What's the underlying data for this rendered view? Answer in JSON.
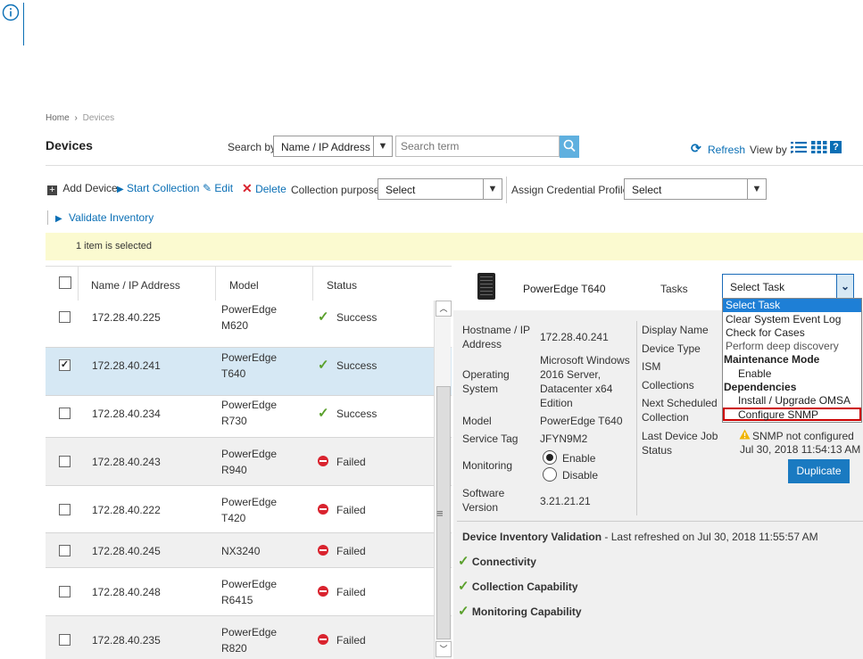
{
  "breadcrumb": {
    "home": "Home",
    "sep": "›",
    "current": "Devices"
  },
  "page_title": "Devices",
  "search": {
    "label": "Search by",
    "field_value": "Name / IP Address",
    "placeholder": "Search term"
  },
  "view": {
    "refresh": "Refresh",
    "view_by": "View by :",
    "help": "?"
  },
  "toolbar": {
    "add_device": "Add Device",
    "start_collection": "Start Collection",
    "edit": "Edit",
    "delete": "Delete",
    "collection_purpose_label": "Collection purpose",
    "collection_purpose_value": "Select",
    "assign_credential_label": "Assign Credential Profile",
    "assign_credential_value": "Select",
    "validate_inventory": "Validate Inventory"
  },
  "selection_banner": "1 item is selected",
  "table": {
    "headers": {
      "name": "Name / IP Address",
      "model": "Model",
      "status": "Status"
    },
    "rows": [
      {
        "ip": "172.28.40.225",
        "model_line1": "PowerEdge",
        "model_line2": "M620",
        "status": "Success",
        "checked": false
      },
      {
        "ip": "172.28.40.241",
        "model_line1": "PowerEdge",
        "model_line2": "T640",
        "status": "Success",
        "checked": true
      },
      {
        "ip": "172.28.40.234",
        "model_line1": "PowerEdge",
        "model_line2": "R730",
        "status": "Success",
        "checked": false
      },
      {
        "ip": "172.28.40.243",
        "model_line1": "PowerEdge",
        "model_line2": "R940",
        "status": "Failed",
        "checked": false
      },
      {
        "ip": "172.28.40.222",
        "model_line1": "PowerEdge",
        "model_line2": "T420",
        "status": "Failed",
        "checked": false
      },
      {
        "ip": "172.28.40.245",
        "model_line1": "NX3240",
        "model_line2": "",
        "status": "Failed",
        "checked": false
      },
      {
        "ip": "172.28.40.248",
        "model_line1": "PowerEdge",
        "model_line2": "R6415",
        "status": "Failed",
        "checked": false
      },
      {
        "ip": "172.28.40.235",
        "model_line1": "PowerEdge",
        "model_line2": "R820",
        "status": "Failed",
        "checked": false
      }
    ]
  },
  "details": {
    "device_name": "PowerEdge T640",
    "tasks_label": "Tasks",
    "tasks_value": "Select Task",
    "hostname_label_1": "Hostname / IP",
    "hostname_label_2": "Address",
    "hostname_value": "172.28.40.241",
    "os_label_1": "Operating",
    "os_label_2": "System",
    "os_value_1": "Microsoft Windows",
    "os_value_2": "2016 Server,",
    "os_value_3": "Datacenter x64",
    "os_value_4": "Edition",
    "model_label": "Model",
    "model_value": "PowerEdge T640",
    "service_tag_label": "Service Tag",
    "service_tag_value": "JFYN9M2",
    "monitoring_label": "Monitoring",
    "monitoring_enable": "Enable",
    "monitoring_disable": "Disable",
    "software_label_1": "Software",
    "software_label_2": "Version",
    "software_value": "3.21.21.21",
    "display_name_label": "Display Name",
    "device_type_label": "Device Type",
    "ism_label": "ISM",
    "collections_label": "Collections",
    "next_sched_label_1": "Next Scheduled",
    "next_sched_label_2": "Collection",
    "last_job_label_1": "Last Device Job",
    "last_job_label_2": "Status",
    "snmp_warning": "SNMP not configured",
    "last_job_time": "Jul 30, 2018 11:54:13 AM",
    "duplicate_button": "Duplicate"
  },
  "task_options": [
    "Select Task",
    "Clear System Event Log",
    "Check for Cases",
    "Perform deep discovery",
    "Maintenance Mode",
    "Enable",
    "Dependencies",
    "Install / Upgrade OMSA",
    "Configure SNMP"
  ],
  "validation": {
    "title": "Device Inventory Validation",
    "refreshed": "- Last refreshed on Jul 30, 2018 11:55:57 AM",
    "items": [
      "Connectivity",
      "Collection Capability",
      "Monitoring Capability"
    ]
  },
  "colors": {
    "accent": "#0a6fb5",
    "banner": "#fbfad0",
    "selected_row": "#d6e8f4",
    "failed": "#d9232e",
    "success": "#5aa02c",
    "highlight_border": "#cc0000"
  }
}
